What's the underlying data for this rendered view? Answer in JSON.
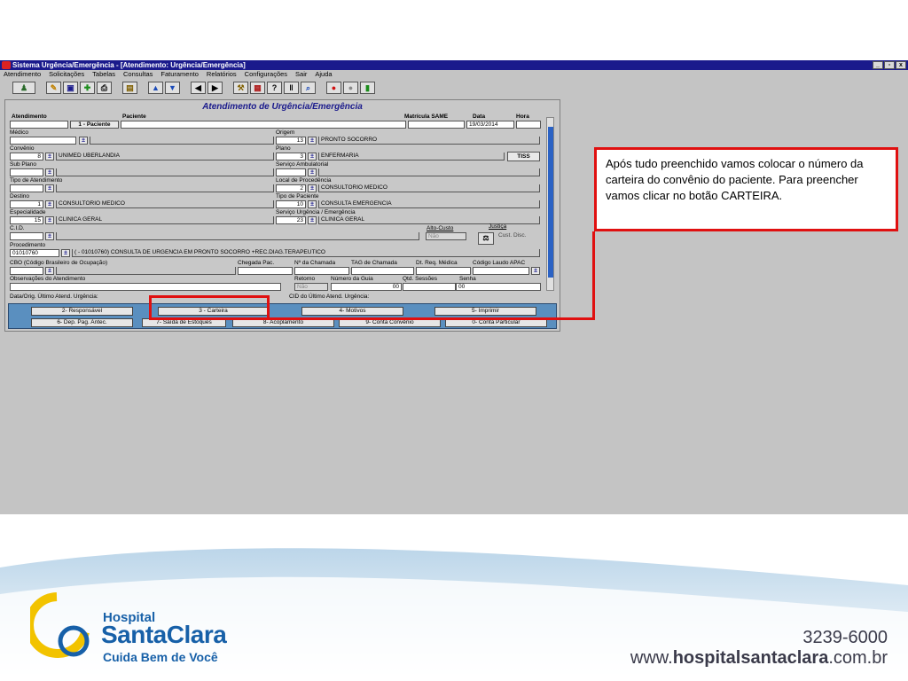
{
  "window": {
    "title": "Sistema Urgência/Emergência - [Atendimento: Urgência/Emergência]",
    "controls": [
      "_",
      "▫",
      "x"
    ]
  },
  "menu": [
    "Atendimento",
    "Solicitações",
    "Tabelas",
    "Consultas",
    "Faturamento",
    "Relatórios",
    "Configurações",
    "Sair",
    "Ajuda"
  ],
  "toolbar_icons": [
    "users-icon",
    "edit-icon",
    "save-icon",
    "add-icon",
    "print-icon",
    "archive-icon",
    "up-arrow-icon",
    "down-arrow-icon",
    "first-record-icon",
    "last-record-icon",
    "tools-icon",
    "report-icon",
    "help-icon",
    "barcode-icon",
    "search-icon",
    "red-record-icon",
    "gray-record-icon",
    "exit-icon"
  ],
  "form": {
    "title": "Atendimento de Urgência/Emergência",
    "labels": {
      "atendimento": "Atendimento",
      "paciente": "Paciente",
      "paciente_btn": "1 - Paciente",
      "matricula": "Matrícula SAME",
      "data": "Data",
      "hora": "Hora",
      "medico": "Médico",
      "origem": "Origem",
      "convenio": "Convênio",
      "plano": "Plano",
      "sub_plano": "Sub Plano",
      "servico_amb": "Serviço Ambulatorial",
      "tipo_atend": "Tipo de Atendimento",
      "local_proc": "Local de Procedência",
      "destino": "Destino",
      "tipo_paciente": "Tipo de Paciente",
      "especialidade": "Especialidade",
      "servico_urg": "Serviço Urgência / Emergência",
      "cid": "C.I.D.",
      "alto_custo": "Alto-Custo",
      "justica": "Justiça",
      "cust_disc": "Cust. Disc.",
      "procedimento": "Procedimento",
      "cbo": "CBO (Código Brasileiro de Ocupação)",
      "chegada": "Chegada Pac.",
      "num_chamada": "Nº da Chamada",
      "tag_chamada": "TAG de Chamada",
      "dt_req": "Dt. Req. Médica",
      "cod_laudo": "Código Laudo APAC",
      "observacoes": "Observações do Atendimento",
      "retorno": "Retorno",
      "num_guia": "Número da Guia",
      "qtd_sessoes": "Qtd. Sessões",
      "senha": "Senha",
      "data_orig": "Data/Orig. Último Atend. Urgência:",
      "cid_ultimo": "CID do Último Atend. Urgência:"
    },
    "values": {
      "data": "19/03/2014",
      "origem_code": "13",
      "origem_desc": "PRONTO SOCORRO",
      "convenio_code": "8",
      "convenio_desc": "UNIMED UBERLANDIA",
      "tiss": "TISS",
      "plano_code": "3",
      "plano_desc": "ENFERMARIA",
      "local_code": "2",
      "local_desc": "CONSULTORIO MEDICO",
      "destino_code": "1",
      "destino_desc": "CONSULTORIO MEDICO",
      "tipo_pac_code": "10",
      "tipo_pac_desc": "CONSULTA EMERGENCIA",
      "espec_code": "15",
      "espec_desc": "CLINICA GERAL",
      "serv_urg_code": "23",
      "serv_urg_desc": "CLINICA GERAL",
      "alto_custo": "Não",
      "proc_code": "01010760",
      "proc_desc": "( - 01010760)  CONSULTA DE URGENCIA EM PRONTO SOCORRO +REC.DIAG.TERAPEUTICO",
      "retorno": "Não",
      "num_guia": "00",
      "senha": "00"
    },
    "buttons": [
      "2- Responsável",
      "3 - Carteira",
      "4- Motivos",
      "5- Imprimir",
      "6- Dep. Pag. Antec.",
      "7- Saída de Estoques",
      "8- Acoplamento",
      "9- Conta Convênio",
      "0- Conta Particular"
    ]
  },
  "callout": "Após tudo preenchido vamos colocar o número da carteira do convênio do paciente.  Para preencher vamos clicar no botão CARTEIRA.",
  "footer": {
    "brand_line1": "Hospital",
    "brand_line2": "SantaClara",
    "brand_line3": "Cuida Bem de Você",
    "phone": "3239-6000",
    "site_prefix": "www.",
    "site_bold": "hospitalsantaclara",
    "site_suffix": ".com.br",
    "colors": {
      "brand_blue": "#1760a8",
      "logo_yellow": "#f2c300",
      "highlight_red": "#e01010"
    }
  }
}
